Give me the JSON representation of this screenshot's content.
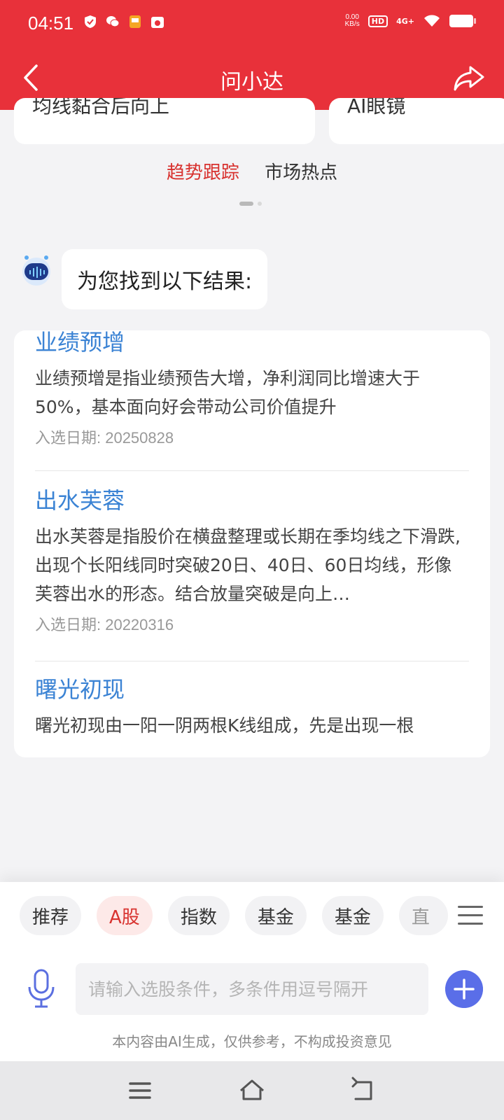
{
  "status_bar": {
    "time": "04:51",
    "net_speed_value": "0.00",
    "net_speed_unit": "KB/s",
    "hd": "HD",
    "signal": "4G+"
  },
  "header": {
    "title": "问小达",
    "back_icon": "chevron-left-icon",
    "share_icon": "share-arrow-icon"
  },
  "top_cards": [
    {
      "partial_text": "均线黏合后向上"
    },
    {
      "partial_text": "AI眼镜"
    }
  ],
  "tabs": [
    {
      "label": "趋势跟踪",
      "active": true
    },
    {
      "label": "市场热点",
      "active": false
    }
  ],
  "chat": {
    "bot_message": "为您找到以下结果:"
  },
  "results": [
    {
      "title": "业绩预增",
      "description": "业绩预增是指业绩预告大增，净利润同比增速大于50%，基本面向好会带动公司价值提升",
      "date": "入选日期: 20250828"
    },
    {
      "title": "出水芙蓉",
      "description": "出水芙蓉是指股价在横盘整理或长期在季均线之下滑跌,出现个长阳线同时突破20日、40日、60日均线，形像芙蓉出水的形态。结合放量突破是向上…",
      "date": "入选日期: 20220316"
    },
    {
      "title": "曙光初现",
      "description": "曙光初现由一阳一阴两根K线组成，先是出现一根"
    }
  ],
  "chips": [
    {
      "label": "推荐",
      "active": false
    },
    {
      "label": "A股",
      "active": true
    },
    {
      "label": "指数",
      "active": false
    },
    {
      "label": "基金",
      "active": false
    },
    {
      "label": "基金",
      "active": false
    },
    {
      "label": "直",
      "active": false
    }
  ],
  "input": {
    "placeholder": "请输入选股条件，多条件用逗号隔开",
    "value": ""
  },
  "disclaimer": "本内容由AI生成，仅供参考，不构成投资意见",
  "colors": {
    "brand_red": "#e8313a",
    "link_blue": "#3b83d4",
    "active_chip_bg": "#fde9e8"
  }
}
